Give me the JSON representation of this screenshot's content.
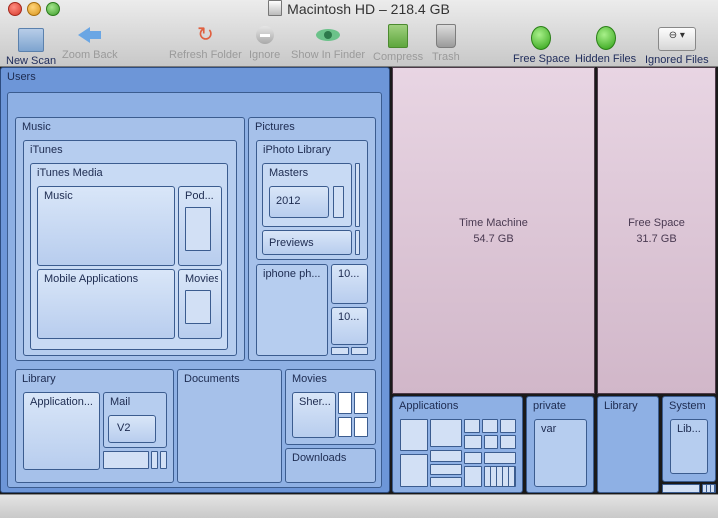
{
  "window": {
    "title": "Macintosh HD – 218.4 GB"
  },
  "toolbar": {
    "new_scan": "New Scan",
    "zoom_back": "Zoom Back",
    "refresh_folder": "Refresh Folder",
    "ignore": "Ignore",
    "show_in_finder": "Show In Finder",
    "compress": "Compress",
    "trash": "Trash",
    "free_space": "Free Space",
    "hidden_files": "Hidden Files",
    "ignored_files": "Ignored Files",
    "ignored_files_glyph": "⊖ ▾"
  },
  "treemap": {
    "users": "Users",
    "music": "Music",
    "itunes": "iTunes",
    "itunes_media": "iTunes Media",
    "itunes_music": "Music",
    "podcasts": "Pod...",
    "mobile_applications": "Mobile Applications",
    "movies_itunes": "Movies",
    "pictures": "Pictures",
    "iphoto_library": "iPhoto Library",
    "masters": "Masters",
    "year_2012": "2012",
    "previews": "Previews",
    "iphone_ph": "iphone ph...",
    "ten_a": "10...",
    "ten_b": "10...",
    "library_user": "Library",
    "application_support": "Application...",
    "mail": "Mail",
    "v2": "V2",
    "documents": "Documents",
    "movies_user": "Movies",
    "sher": "Sher...",
    "downloads": "Downloads",
    "time_machine": "Time Machine",
    "time_machine_size": "54.7 GB",
    "free_space": "Free Space",
    "free_space_size": "31.7 GB",
    "applications": "Applications",
    "private": "private",
    "var": "var",
    "library_root": "Library",
    "system": "System",
    "system_lib": "Lib..."
  }
}
